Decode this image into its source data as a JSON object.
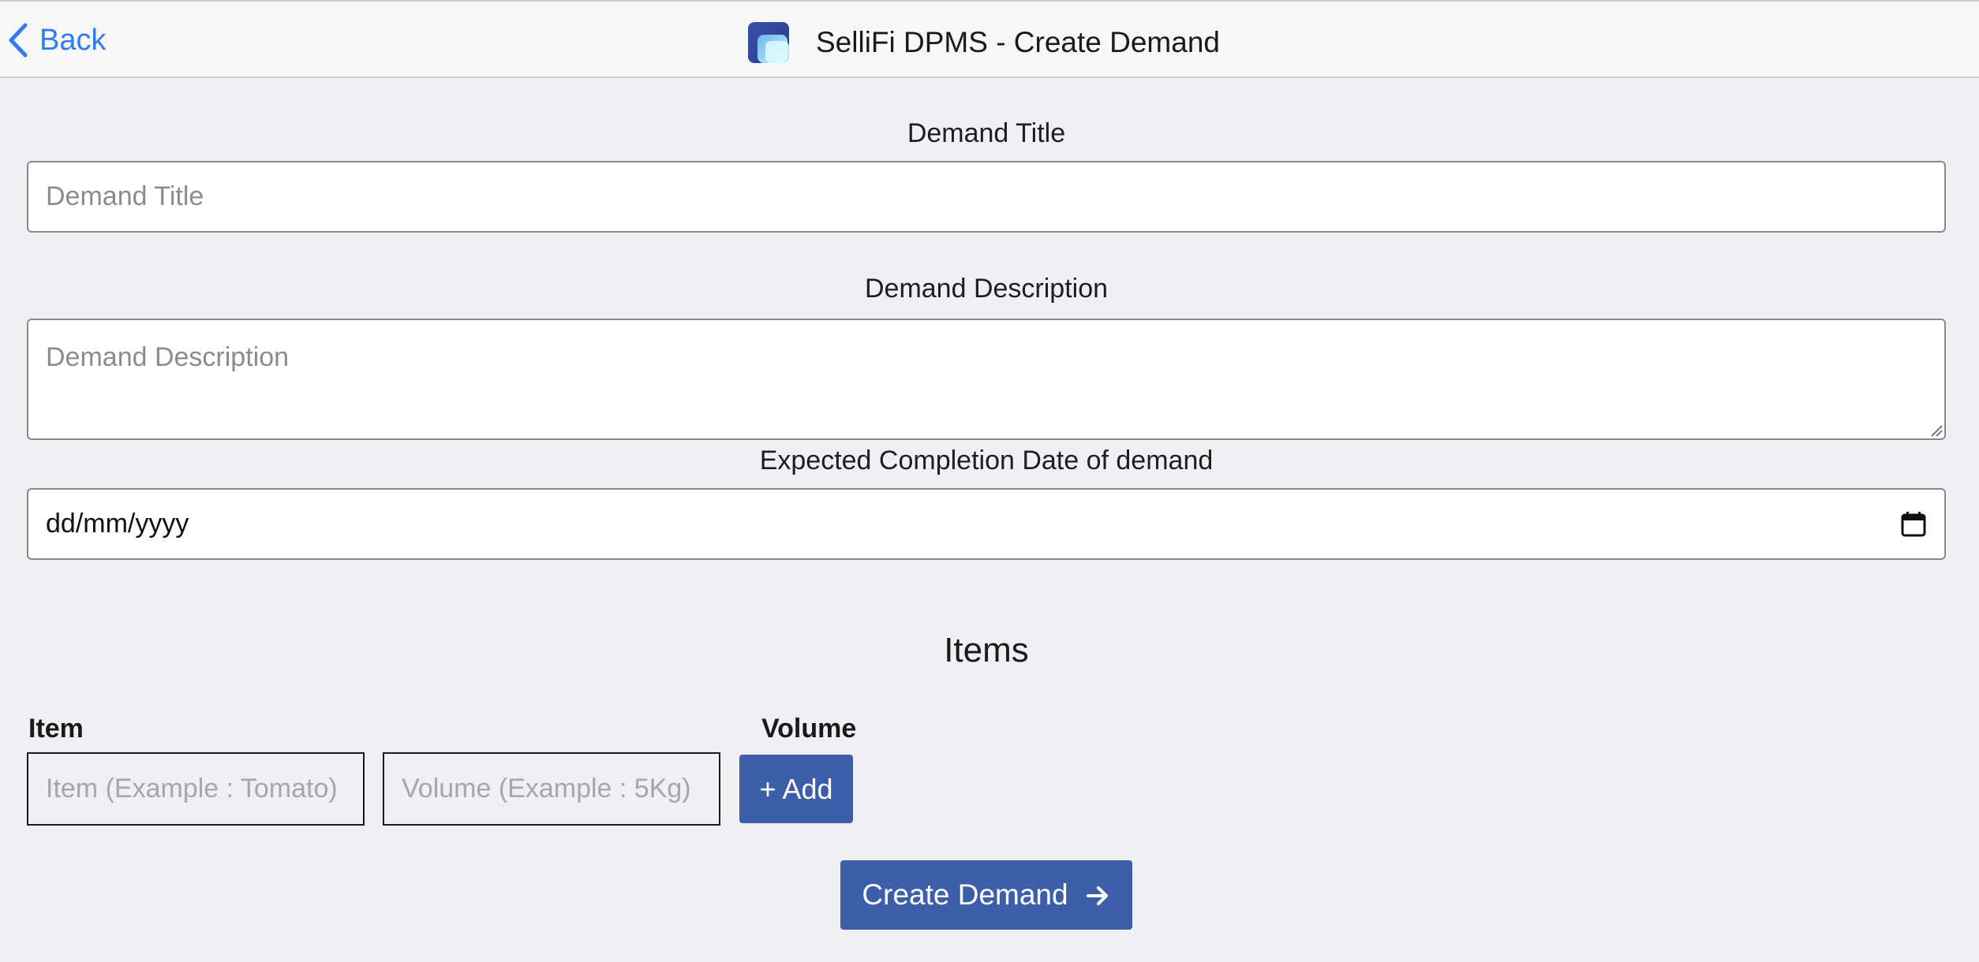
{
  "navbar": {
    "back_label": "Back",
    "title": "SelliFi DPMS - Create Demand",
    "logo_icon": "sellifi-logo-icon"
  },
  "form": {
    "title_label": "Demand Title",
    "title_placeholder": "Demand Title",
    "title_value": "",
    "description_label": "Demand Description",
    "description_placeholder": "Demand Description",
    "description_value": "",
    "date_label": "Expected Completion Date of demand",
    "date_display": "dd/mm/yyyy"
  },
  "items": {
    "heading": "Items",
    "item_column_label": "Item",
    "volume_column_label": "Volume",
    "item_placeholder": "Item (Example : Tomato)",
    "volume_placeholder": "Volume (Example : 5Kg)",
    "add_label": "+ Add"
  },
  "actions": {
    "create_label": "Create Demand"
  },
  "colors": {
    "accent": "#3d5ea8",
    "link": "#2f7cf6",
    "background": "#efeff4"
  }
}
